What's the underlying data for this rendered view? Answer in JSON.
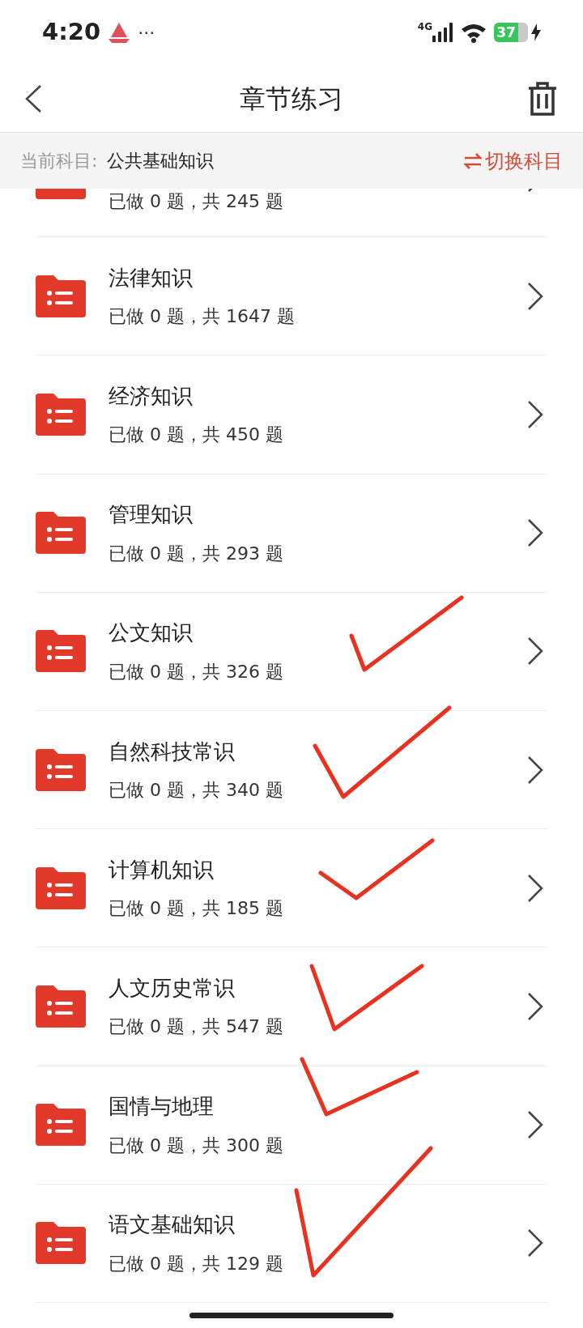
{
  "status_bar": {
    "time": "4:20",
    "more": "···",
    "network": "4G",
    "battery": "37"
  },
  "header": {
    "title": "章节练习"
  },
  "subject_bar": {
    "label": "当前科目:",
    "value": "公共基础知识",
    "switch": "切换科目"
  },
  "chapters": [
    {
      "progress": "已做 0 题，共 245 题",
      "marked": false
    },
    {
      "title": "法律知识",
      "progress": "已做 0 题，共 1647 题",
      "marked": false
    },
    {
      "title": "经济知识",
      "progress": "已做 0 题，共 450 题",
      "marked": false
    },
    {
      "title": "管理知识",
      "progress": "已做 0 题，共 293 题",
      "marked": false
    },
    {
      "title": "公文知识",
      "progress": "已做 0 题，共 326 题",
      "marked": true
    },
    {
      "title": "自然科技常识",
      "progress": "已做 0 题，共 340 题",
      "marked": true
    },
    {
      "title": "计算机知识",
      "progress": "已做 0 题，共 185 题",
      "marked": true
    },
    {
      "title": "人文历史常识",
      "progress": "已做 0 题，共 547 题",
      "marked": true
    },
    {
      "title": "国情与地理",
      "progress": "已做 0 题，共 300 题",
      "marked": true
    },
    {
      "title": "语文基础知识",
      "progress": "已做 0 题，共 129 题",
      "marked": true
    }
  ]
}
